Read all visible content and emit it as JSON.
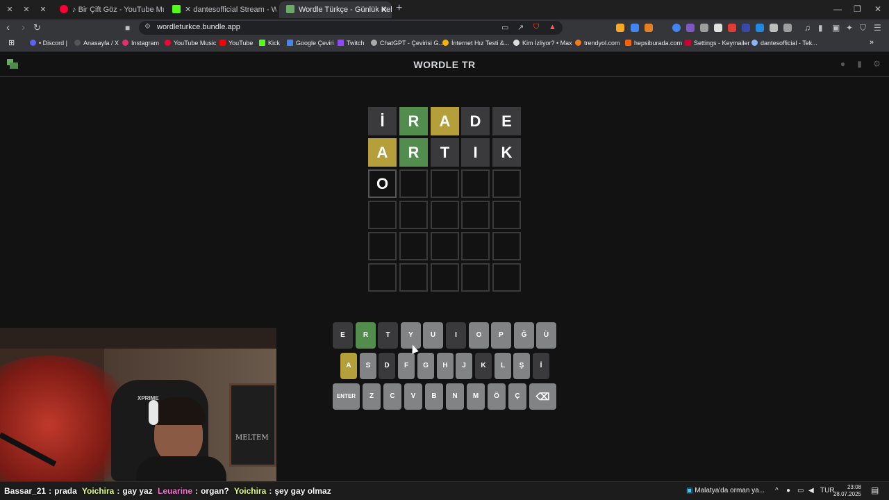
{
  "browser": {
    "tabs": [
      {
        "title": "Bir Çift Göz - YouTube Music",
        "icon": "youtube-music-icon",
        "color": "#ff0033"
      },
      {
        "title": "dantesofficial Stream - Watch Liv",
        "icon": "kick-icon",
        "color": "#53fc18"
      },
      {
        "title": "Wordle Türkçe - Günlük Kelime",
        "icon": "wordle-icon",
        "color": "#6aaa64"
      }
    ],
    "url": "wordleturkce.bundle.app",
    "bookmarks": [
      {
        "label": "• Discord |",
        "color": "#5865f2"
      },
      {
        "label": "Anasayfa / X",
        "color": "#000000"
      },
      {
        "label": "Instagram",
        "color": "#e1306c"
      },
      {
        "label": "YouTube Music",
        "color": "#ff0033"
      },
      {
        "label": "YouTube",
        "color": "#ff0000"
      },
      {
        "label": "Kick",
        "color": "#53fc18"
      },
      {
        "label": "Google Çeviri",
        "color": "#4285f4"
      },
      {
        "label": "Twitch",
        "color": "#9146ff"
      },
      {
        "label": "ChatGPT - Çevirisi G...",
        "color": "#aaaaaa"
      },
      {
        "label": "İnternet Hız Testi &...",
        "color": "#f4b400"
      },
      {
        "label": "Kim İzliyor? • Max",
        "color": "#ffffff"
      },
      {
        "label": "trendyol.com",
        "color": "#f27a1a"
      },
      {
        "label": "hepsiburada.com",
        "color": "#ff6000"
      },
      {
        "label": "Settings - Keymailer",
        "color": "#cc0033"
      },
      {
        "label": "dantesofficial - Tek...",
        "color": "#8ab4f8"
      }
    ]
  },
  "game": {
    "title": "WORDLE TR",
    "colors": {
      "correct": "#538d4e",
      "present": "#b59f3b",
      "absent": "#3a3a3c"
    },
    "board": [
      [
        {
          "l": "İ",
          "s": "absent"
        },
        {
          "l": "R",
          "s": "correct"
        },
        {
          "l": "A",
          "s": "present"
        },
        {
          "l": "D",
          "s": "absent"
        },
        {
          "l": "E",
          "s": "absent"
        }
      ],
      [
        {
          "l": "A",
          "s": "present"
        },
        {
          "l": "R",
          "s": "correct"
        },
        {
          "l": "T",
          "s": "absent"
        },
        {
          "l": "I",
          "s": "absent"
        },
        {
          "l": "K",
          "s": "absent"
        }
      ],
      [
        {
          "l": "O",
          "s": "tbd"
        },
        {
          "l": "",
          "s": "empty"
        },
        {
          "l": "",
          "s": "empty"
        },
        {
          "l": "",
          "s": "empty"
        },
        {
          "l": "",
          "s": "empty"
        }
      ],
      [
        {
          "l": "",
          "s": "empty"
        },
        {
          "l": "",
          "s": "empty"
        },
        {
          "l": "",
          "s": "empty"
        },
        {
          "l": "",
          "s": "empty"
        },
        {
          "l": "",
          "s": "empty"
        }
      ],
      [
        {
          "l": "",
          "s": "empty"
        },
        {
          "l": "",
          "s": "empty"
        },
        {
          "l": "",
          "s": "empty"
        },
        {
          "l": "",
          "s": "empty"
        },
        {
          "l": "",
          "s": "empty"
        }
      ],
      [
        {
          "l": "",
          "s": "empty"
        },
        {
          "l": "",
          "s": "empty"
        },
        {
          "l": "",
          "s": "empty"
        },
        {
          "l": "",
          "s": "empty"
        },
        {
          "l": "",
          "s": "empty"
        }
      ]
    ],
    "keyboard": [
      [
        {
          "k": "E",
          "s": "absent"
        },
        {
          "k": "R",
          "s": "correct"
        },
        {
          "k": "T",
          "s": "absent"
        },
        {
          "k": "Y",
          "s": ""
        },
        {
          "k": "U",
          "s": ""
        },
        {
          "k": "I",
          "s": "absent"
        },
        {
          "k": "O",
          "s": ""
        },
        {
          "k": "P",
          "s": ""
        },
        {
          "k": "Ğ",
          "s": ""
        },
        {
          "k": "Ü",
          "s": ""
        }
      ],
      [
        {
          "k": "A",
          "s": "present"
        },
        {
          "k": "S",
          "s": ""
        },
        {
          "k": "D",
          "s": "absent"
        },
        {
          "k": "F",
          "s": ""
        },
        {
          "k": "G",
          "s": ""
        },
        {
          "k": "H",
          "s": ""
        },
        {
          "k": "J",
          "s": ""
        },
        {
          "k": "K",
          "s": "absent"
        },
        {
          "k": "L",
          "s": ""
        },
        {
          "k": "Ş",
          "s": ""
        },
        {
          "k": "İ",
          "s": "absent"
        }
      ],
      [
        {
          "k": "ENTER",
          "s": "",
          "wide": true
        },
        {
          "k": "Z",
          "s": ""
        },
        {
          "k": "C",
          "s": ""
        },
        {
          "k": "V",
          "s": ""
        },
        {
          "k": "B",
          "s": ""
        },
        {
          "k": "N",
          "s": ""
        },
        {
          "k": "M",
          "s": ""
        },
        {
          "k": "Ö",
          "s": ""
        },
        {
          "k": "Ç",
          "s": ""
        },
        {
          "k": "⌫",
          "s": "",
          "wide": true
        }
      ]
    ]
  },
  "stream": {
    "chair_brand": "XPRIME",
    "board_text": "MELTEM",
    "chat": [
      {
        "user": "Bassar_21",
        "msg": "prada",
        "color": "#ffffff"
      },
      {
        "user": "Yoichira",
        "msg": "gay yaz",
        "color": "#e6ff7a"
      },
      {
        "user": "Leuarine",
        "msg": "organ?",
        "color": "#ff6fd8"
      },
      {
        "user": "Yoichira",
        "msg": "şey gay olmaz",
        "color": "#e6ff7a"
      }
    ]
  },
  "taskbar": {
    "news": "Malatya'da orman ya...",
    "lang": "TUR",
    "time": "23:08",
    "date": "28.07.2025"
  }
}
